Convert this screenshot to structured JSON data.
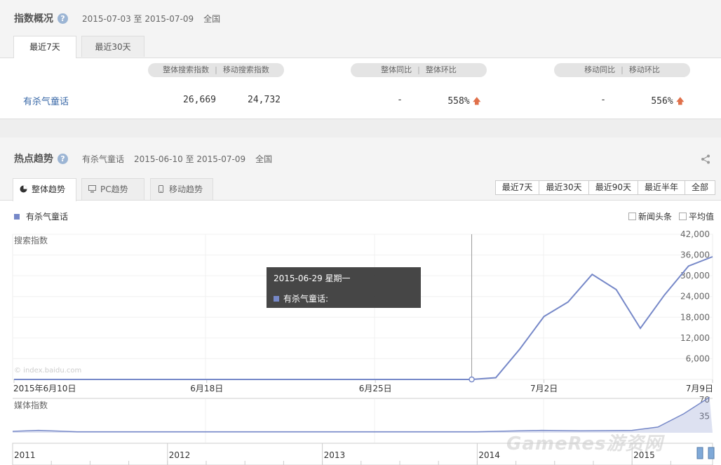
{
  "overview": {
    "title": "指数概况",
    "help": "?",
    "date_range": "2015-07-03 至 2015-07-09",
    "region": "全国",
    "tabs": [
      "最近7天",
      "最近30天"
    ],
    "headers": {
      "search_total": "整体搜索指数",
      "search_mobile": "移动搜索指数",
      "overall_yoy": "整体同比",
      "overall_mom": "整体环比",
      "mobile_yoy": "移动同比",
      "mobile_mom": "移动环比",
      "sep": "|"
    },
    "row": {
      "keyword": "有杀气童话",
      "search_total": "26,669",
      "search_mobile": "24,732",
      "overall_yoy": "-",
      "overall_mom": "558%",
      "mobile_yoy": "-",
      "mobile_mom": "556%",
      "arrow": "🡅"
    }
  },
  "trend": {
    "title": "热点趋势",
    "help": "?",
    "keyword": "有杀气童话",
    "date_range": "2015-06-10 至 2015-07-09",
    "region": "全国",
    "share_icon": "share-icon",
    "tabs": [
      "整体趋势",
      "PC趋势",
      "移动趋势"
    ],
    "ranges": [
      "最近7天",
      "最近30天",
      "最近90天",
      "最近半年",
      "全部"
    ],
    "legend": "有杀气童话",
    "checks": [
      "新闻头条",
      "平均值"
    ]
  },
  "chart_data": [
    {
      "type": "line",
      "ylabel": "搜索指数",
      "ylim": [
        0,
        42000
      ],
      "yticks": [
        "6,000",
        "12,000",
        "18,000",
        "24,000",
        "30,000",
        "36,000",
        "42,000"
      ],
      "xticks": [
        "2015年6月10日",
        "6月18日",
        "6月25日",
        "7月2日",
        "7月9日"
      ],
      "series": [
        {
          "name": "有杀气童话",
          "color": "#7688c8",
          "x": [
            "06-10",
            "06-11",
            "06-12",
            "06-13",
            "06-14",
            "06-15",
            "06-16",
            "06-17",
            "06-18",
            "06-19",
            "06-20",
            "06-21",
            "06-22",
            "06-23",
            "06-24",
            "06-25",
            "06-26",
            "06-27",
            "06-28",
            "06-29",
            "06-30",
            "07-01",
            "07-02",
            "07-03",
            "07-04",
            "07-05",
            "07-06",
            "07-07",
            "07-08",
            "07-09"
          ],
          "values": [
            0,
            0,
            0,
            0,
            0,
            0,
            0,
            0,
            0,
            0,
            0,
            0,
            0,
            0,
            0,
            0,
            0,
            0,
            0,
            0,
            500,
            8800,
            18200,
            22400,
            30400,
            26000,
            14800,
            24400,
            32800,
            35500
          ]
        }
      ],
      "watermark": "© index.baidu.com",
      "tooltip": {
        "date": "2015-06-29 星期一",
        "label": "有杀气童话:"
      }
    },
    {
      "type": "area",
      "ylabel": "媒体指数",
      "ylim": [
        0,
        80
      ],
      "yticks": [
        "35",
        "70"
      ],
      "xticks": [
        "2011",
        "2012",
        "2013",
        "2014",
        "2015"
      ],
      "series": [
        {
          "name": "有杀气童话",
          "x": [
            "2011-01",
            "2011-03",
            "2011-06",
            "2012-01",
            "2013-01",
            "2014-01",
            "2014-06",
            "2014-09",
            "2015-01",
            "2015-03",
            "2015-05",
            "2015-07"
          ],
          "values": [
            3,
            5,
            2,
            2,
            2,
            2,
            5,
            4,
            5,
            12,
            40,
            75
          ]
        }
      ]
    }
  ],
  "site_watermark": "GameRes游资网"
}
